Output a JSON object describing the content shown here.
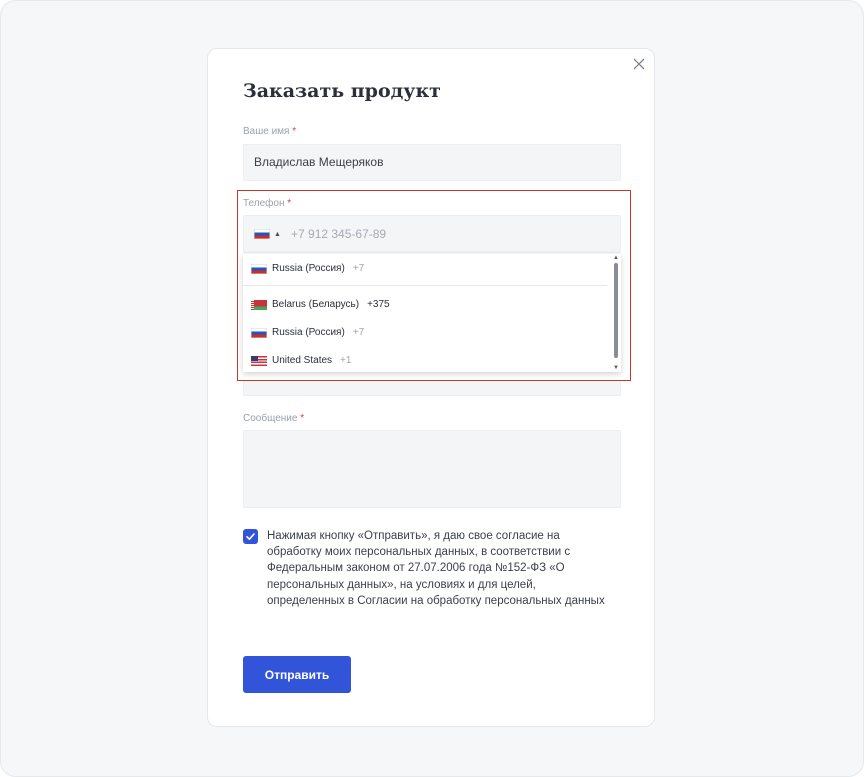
{
  "modal": {
    "title": "Заказать продукт",
    "close_icon": "close-icon"
  },
  "form": {
    "required_mark": "*",
    "name": {
      "label": "Ваше имя",
      "value": "Владислав Мещеряков"
    },
    "phone": {
      "label": "Телефон",
      "placeholder": "+7 912 345-67-89",
      "selected_country_flag": "russia-flag-icon"
    },
    "country_dropdown": {
      "preferred": [
        {
          "name": "Russia (Россия)",
          "code": "+7",
          "flag": "russia-flag-icon"
        }
      ],
      "items": [
        {
          "name": "Belarus (Беларусь)",
          "code": "+375",
          "flag": "belarus-flag-icon"
        },
        {
          "name": "Russia (Россия)",
          "code": "+7",
          "flag": "russia-flag-icon"
        },
        {
          "name": "United States",
          "code": "+1",
          "flag": "usa-flag-icon"
        }
      ]
    },
    "message": {
      "label": "Сообщение"
    },
    "consent": {
      "checked": true,
      "text": "Нажимая кнопку «Отправить», я даю свое согласие на обработку моих персональных данных, в соответствии с Федеральным законом от 27.07.2006 года №152-ФЗ «О персональных данных», на условиях и для целей, определенных в Согласии на обработку персональных данных"
    },
    "submit_label": "Отправить"
  },
  "colors": {
    "accent": "#3254d8",
    "required": "#e53935",
    "highlight": "#c0392b"
  }
}
